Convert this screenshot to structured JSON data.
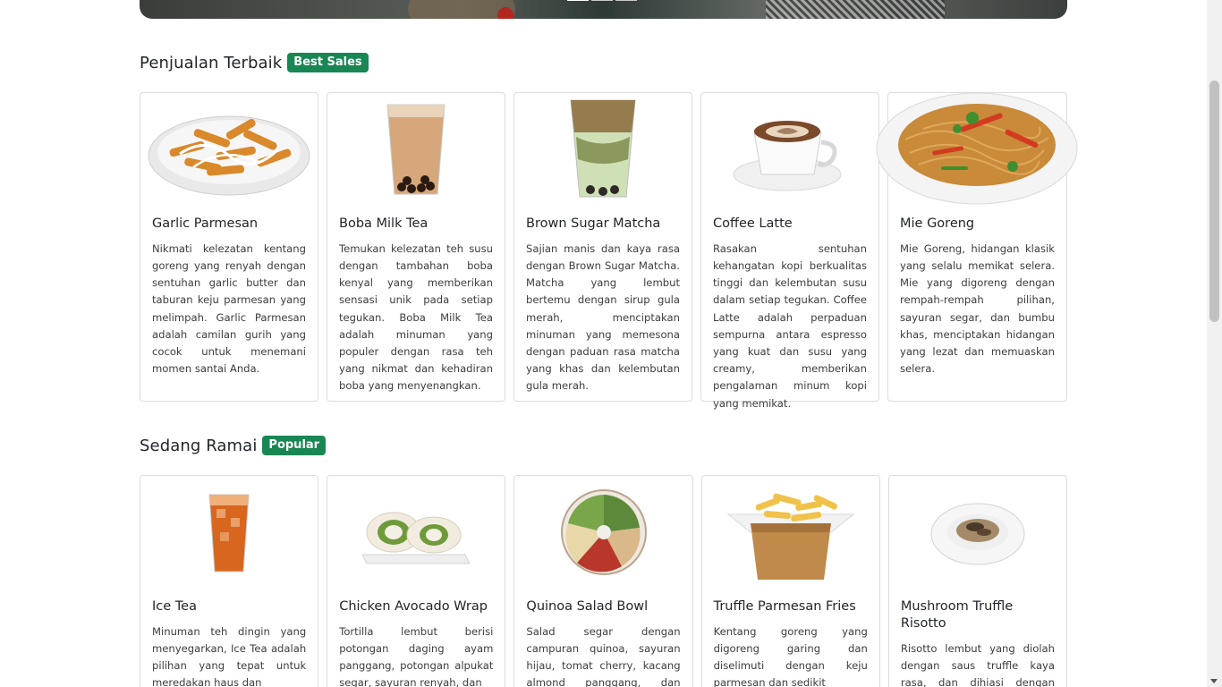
{
  "carousel": {
    "indicators": 3,
    "active_index": 0
  },
  "sections": [
    {
      "title": "Penjualan Terbaik",
      "badge": "Best Sales",
      "items": [
        {
          "name": "Garlic Parmesan",
          "image": "garlic-parmesan-fries-icon",
          "desc": "Nikmati kelezatan kentang goreng yang renyah dengan sentuhan garlic butter dan taburan keju parmesan yang melimpah. Garlic Parmesan adalah camilan gurih yang cocok untuk menemani momen santai Anda."
        },
        {
          "name": "Boba Milk Tea",
          "image": "boba-milk-tea-icon",
          "desc": "Temukan kelezatan teh susu dengan tambahan boba kenyal yang memberikan sensasi unik pada setiap tegukan. Boba Milk Tea adalah minuman yang populer dengan rasa teh yang nikmat dan kehadiran boba yang menyenangkan."
        },
        {
          "name": "Brown Sugar Matcha",
          "image": "brown-sugar-matcha-icon",
          "desc": "Sajian manis dan kaya rasa dengan Brown Sugar Matcha. Matcha yang lembut bertemu dengan sirup gula merah, menciptakan minuman yang memesona dengan paduan rasa matcha yang khas dan kelembutan gula merah."
        },
        {
          "name": "Coffee Latte",
          "image": "coffee-latte-icon",
          "desc": "Rasakan sentuhan kehangatan kopi berkualitas tinggi dan kelembutan susu dalam setiap tegukan. Coffee Latte adalah perpaduan sempurna antara espresso yang kuat dan susu yang creamy, memberikan pengalaman minum kopi yang memikat."
        },
        {
          "name": "Mie Goreng",
          "image": "mie-goreng-icon",
          "desc": "Mie Goreng, hidangan klasik yang selalu memikat selera. Mie yang digoreng dengan rempah-rempah pilihan, sayuran segar, dan bumbu khas, menciptakan hidangan yang lezat dan memuaskan selera."
        }
      ]
    },
    {
      "title": "Sedang Ramai",
      "badge": "Popular",
      "items": [
        {
          "name": "Ice Tea",
          "image": "ice-tea-icon",
          "desc": "Minuman teh dingin yang menyegarkan, Ice Tea adalah pilihan yang tepat untuk meredakan haus dan"
        },
        {
          "name": "Chicken Avocado Wrap",
          "image": "chicken-avocado-wrap-icon",
          "desc": "Tortilla lembut berisi potongan daging ayam panggang, potongan alpukat segar, sayuran renyah, dan"
        },
        {
          "name": "Quinoa Salad Bowl",
          "image": "quinoa-salad-bowl-icon",
          "desc": "Salad segar dengan campuran quinoa, sayuran hijau, tomat cherry, kacang almond panggang, dan dressing"
        },
        {
          "name": "Truffle Parmesan Fries",
          "image": "truffle-parmesan-fries-icon",
          "desc": "Kentang goreng yang digoreng garing dan diselimuti dengan keju parmesan dan sedikit"
        },
        {
          "name": "Mushroom Truffle Risotto",
          "image": "mushroom-truffle-risotto-icon",
          "desc": "Risotto lembut yang diolah dengan saus truffle kaya rasa, dan dihiasi dengan potongan"
        }
      ]
    }
  ],
  "colors": {
    "badge": "#198754",
    "text": "#212529",
    "border": "#dcdcdc"
  }
}
